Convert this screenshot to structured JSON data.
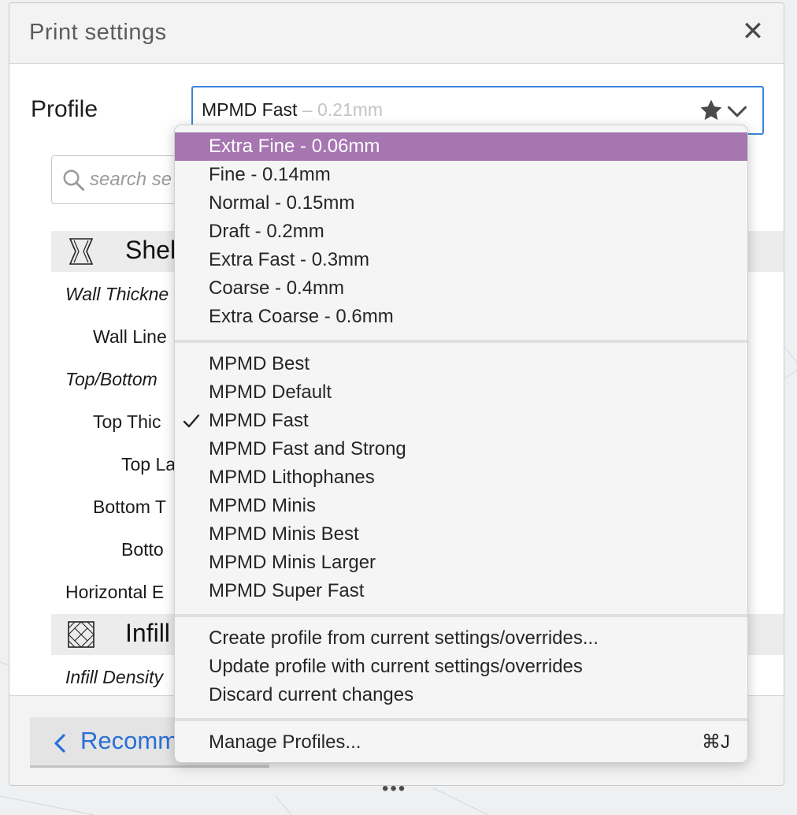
{
  "window": {
    "title": "Print settings",
    "close_label": "✕"
  },
  "profile": {
    "label": "Profile",
    "selected_name": "MPMD Fast",
    "selected_layer": " – 0.21mm"
  },
  "search": {
    "placeholder": "search se"
  },
  "sections": [
    {
      "label": "Shell",
      "settings": [
        "Wall Thickne",
        "Wall Line",
        "Top/Bottom",
        "Top Thic",
        "Top La",
        "Bottom T",
        "Botto",
        "Horizontal E"
      ]
    },
    {
      "label": "Infill",
      "settings": [
        "Infill Density"
      ]
    }
  ],
  "footer": {
    "recommended_label": "Recomm",
    "resize_label": "•••"
  },
  "menu": {
    "group1": [
      "Extra Fine - 0.06mm",
      "Fine - 0.14mm",
      "Normal - 0.15mm",
      "Draft - 0.2mm",
      "Extra Fast - 0.3mm",
      "Coarse - 0.4mm",
      "Extra Coarse - 0.6mm"
    ],
    "group2": [
      "MPMD Best",
      "MPMD Default",
      "MPMD Fast",
      "MPMD Fast and Strong",
      "MPMD Lithophanes",
      "MPMD Minis",
      "MPMD Minis Best",
      "MPMD Minis Larger",
      "MPMD Super Fast"
    ],
    "group3": [
      "Create profile from current settings/overrides...",
      "Update profile with current settings/overrides",
      "Discard current changes"
    ],
    "group4": {
      "label": "Manage Profiles...",
      "shortcut": "⌘J"
    },
    "highlighted_item": "Extra Fine - 0.06mm",
    "checked_item": "MPMD Fast"
  },
  "colors": {
    "highlight": "#a576b0",
    "focus_border": "#3a86d8",
    "link_blue": "#2a6fd6"
  }
}
